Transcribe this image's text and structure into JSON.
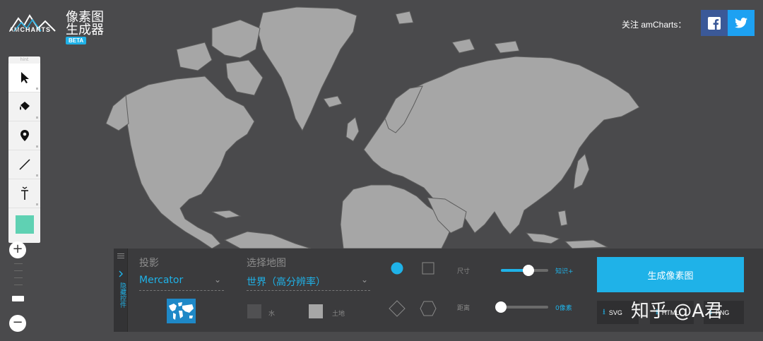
{
  "brand": {
    "logo_text_light": "AM",
    "logo_text_bold": "CHARTS",
    "title_line1": "像素图",
    "title_line2": "生成器",
    "beta": "BETA"
  },
  "header": {
    "follow_text": "关注 amCharts："
  },
  "toolbar": {
    "header": "hint"
  },
  "zoom": {
    "plus": "+",
    "minus": "−"
  },
  "panel": {
    "tab_label": "隐藏控件",
    "projection_label": "投影",
    "projection_value": "Mercator",
    "map_label": "选择地图",
    "map_value": "世界（高分辨率）",
    "water_label": "水",
    "land_label": "土地",
    "size_label": "尺寸",
    "size_value": "知识+",
    "size_fraction": 0.58,
    "spacing_label": "距离",
    "spacing_value": "0像素",
    "spacing_fraction": 0.0,
    "generate_label": "生成像素图",
    "dl_svg": "SVG",
    "dl_html": "HTML",
    "dl_png": "PNG"
  },
  "watermark": "知乎 @A君",
  "colors": {
    "accent": "#1fb2e8",
    "background": "#4a4a4c",
    "land": "#a6a6a6",
    "panel": "#3b3b3d",
    "swatch": "#5fd1b3",
    "facebook": "#3b5998",
    "twitter": "#1da1f2"
  }
}
